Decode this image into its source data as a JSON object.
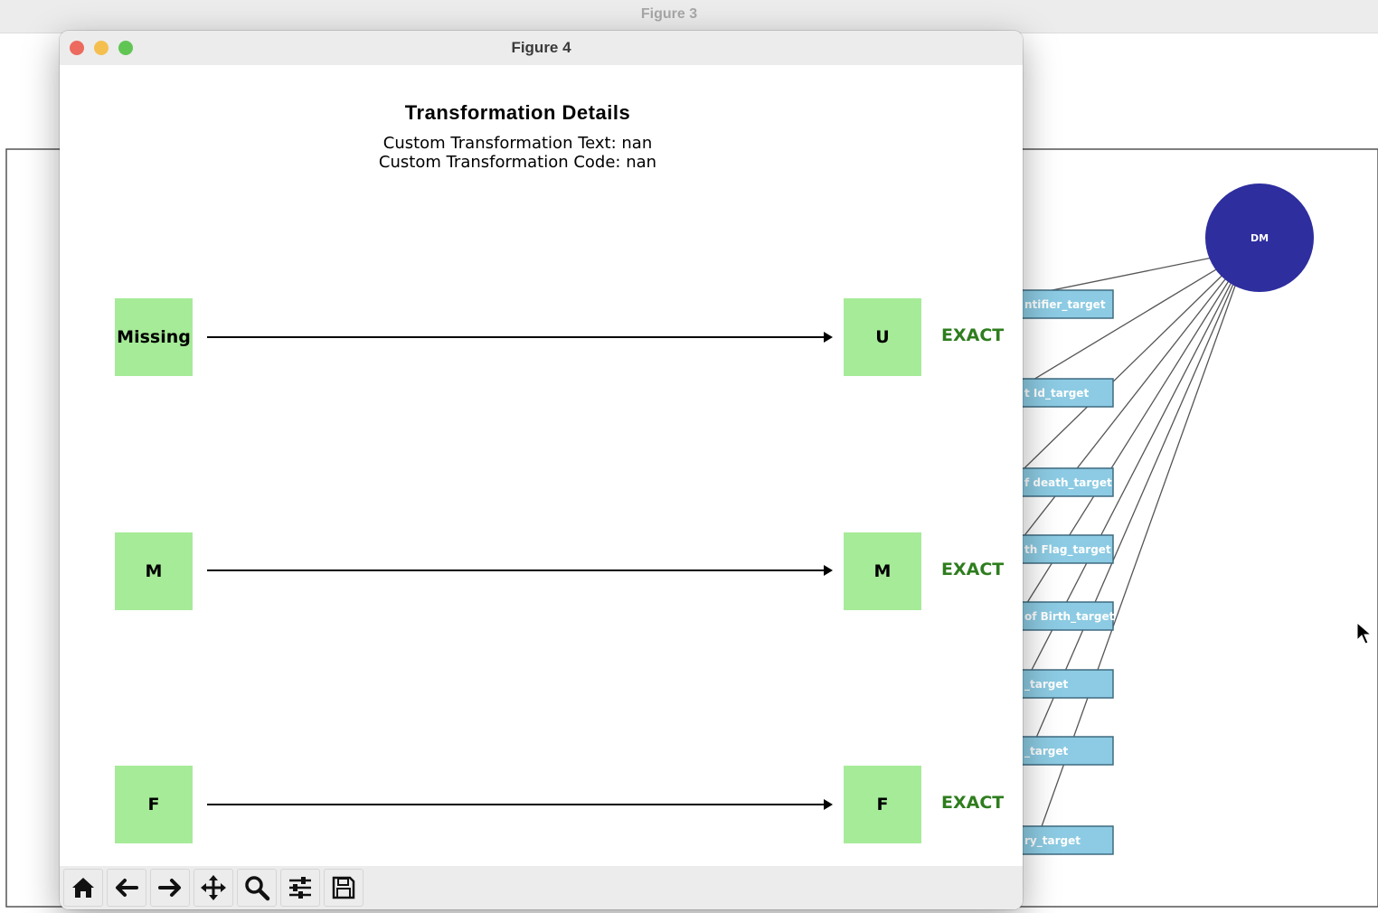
{
  "background_window": {
    "title": "Figure 3",
    "graph": {
      "hub_label": "DM",
      "hub_color": "#2e2e9f",
      "node_color": "#8ccbe3",
      "nodes": [
        "ntifier_target",
        "t Id_target",
        "f death_target",
        "th Flag_target",
        "of Birth_target",
        "_target",
        "_target",
        "ry_target"
      ]
    }
  },
  "window": {
    "title": "Figure 4",
    "plot": {
      "title": "Transformation Details",
      "subtitle_text": "Custom Transformation Text: nan",
      "subtitle_code": "Custom Transformation Code: nan",
      "box_color": "#a6eb98",
      "match_color": "#2e7d1e",
      "mappings": [
        {
          "source": "Missing",
          "target": "U",
          "match": "EXACT"
        },
        {
          "source": "M",
          "target": "M",
          "match": "EXACT"
        },
        {
          "source": "F",
          "target": "F",
          "match": "EXACT"
        }
      ]
    },
    "toolbar": [
      "home-icon",
      "back-arrow-icon",
      "forward-arrow-icon",
      "pan-move-icon",
      "zoom-magnifier-icon",
      "configure-subplots-icon",
      "save-floppy-icon"
    ]
  }
}
